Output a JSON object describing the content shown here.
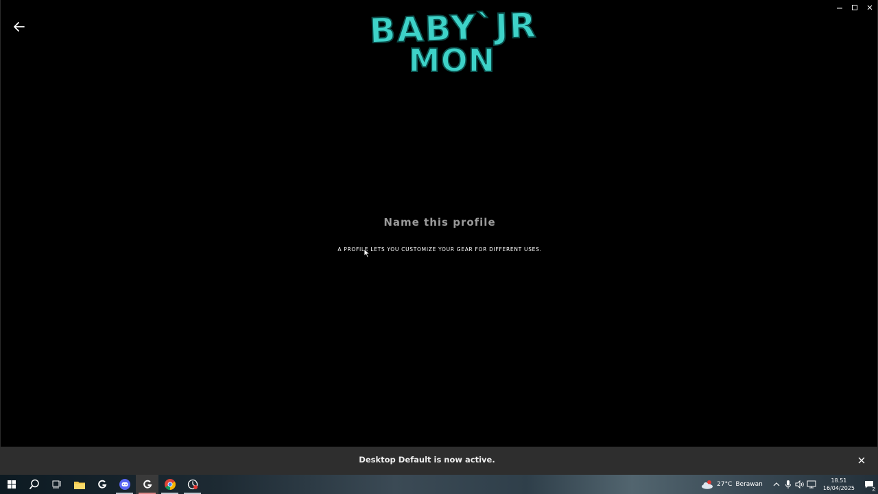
{
  "logo": {
    "line1": "BABY`JR",
    "line2": "MON",
    "color": "#3ed2c8",
    "outline": "#0b4d4a"
  },
  "profile": {
    "title": "Name this profile",
    "subtitle": "A PROFILE LETS YOU CUSTOMIZE YOUR GEAR FOR DIFFERENT USES."
  },
  "toast": {
    "message": "Desktop Default is now active."
  },
  "taskbar": {
    "items": [
      "start-icon",
      "search-icon",
      "task-view-icon",
      "file-explorer-icon",
      "g-hub-icon",
      "discord-icon",
      "g-hub-icon",
      "chrome-icon",
      "recorder-icon"
    ],
    "weather": {
      "temp": "27°C",
      "condition": "Berawan"
    },
    "clock": {
      "time": "18.51",
      "date": "16/04/2025"
    },
    "notifications": "2"
  }
}
